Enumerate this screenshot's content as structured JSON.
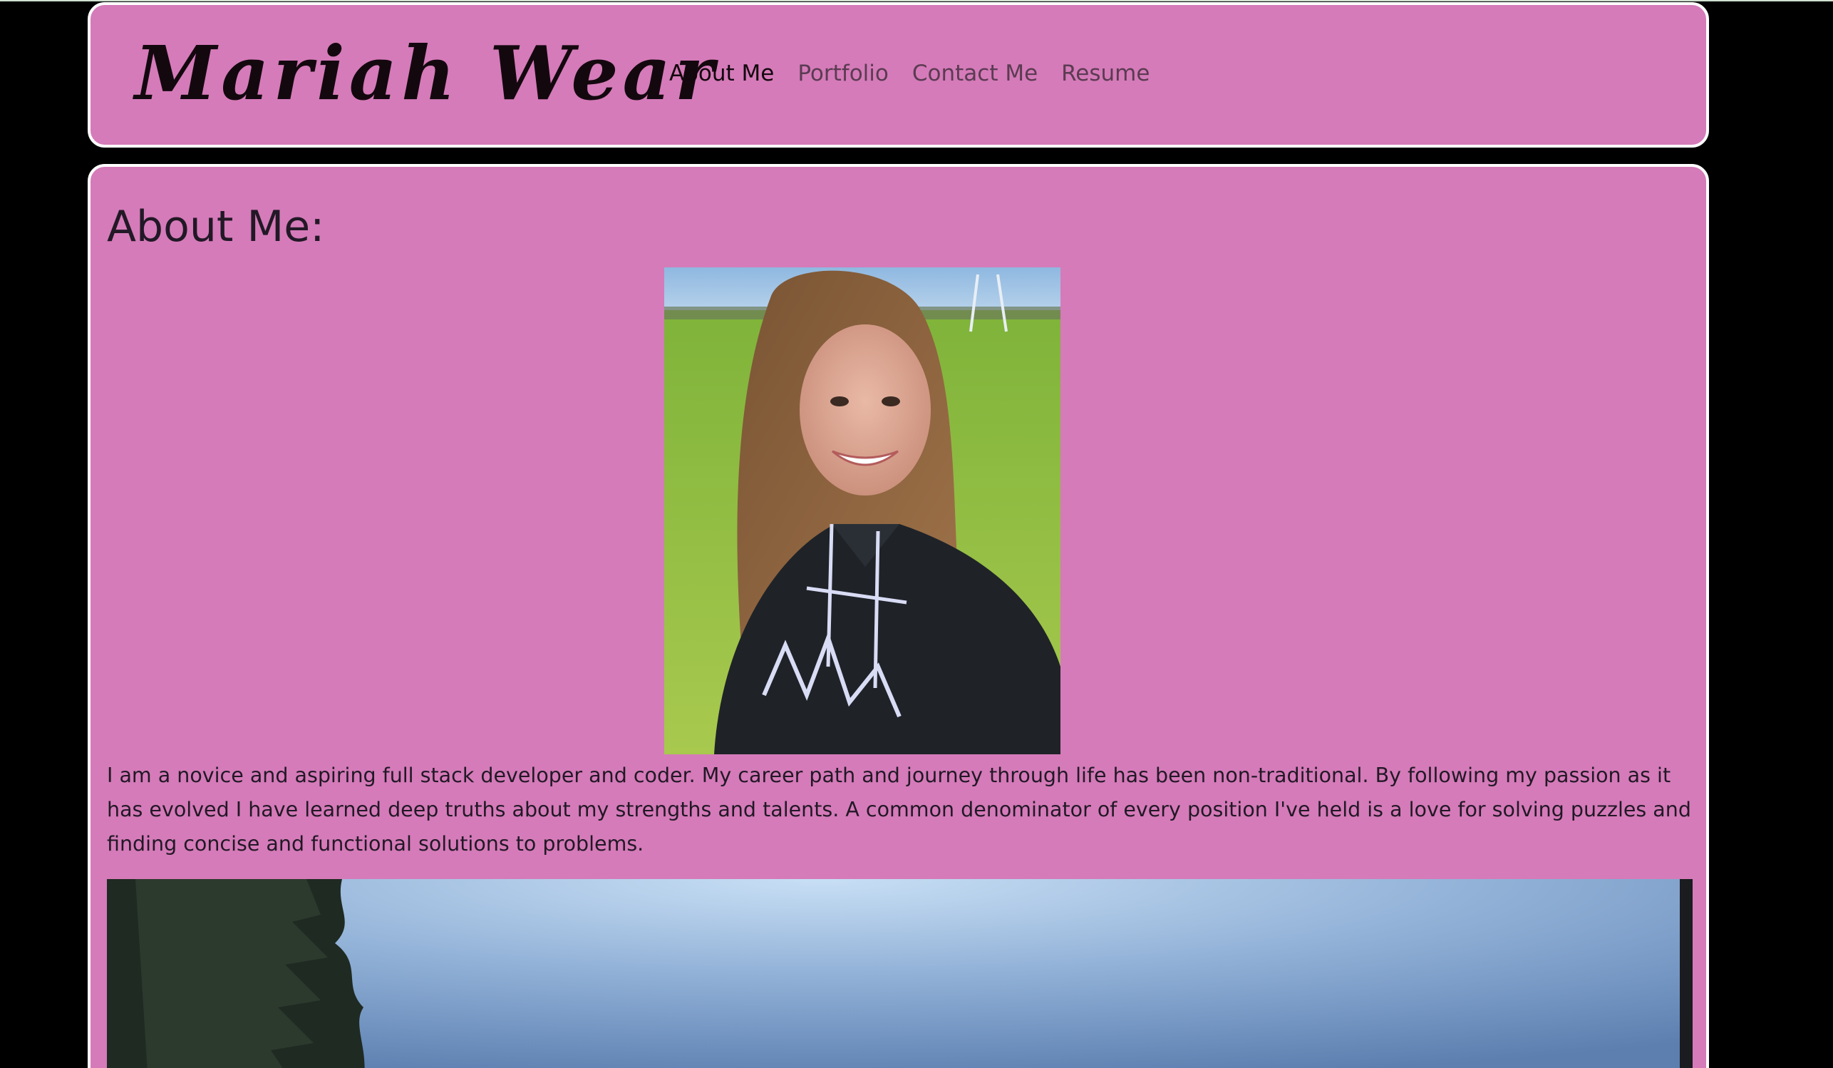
{
  "site": {
    "brand": "Mariah Wear"
  },
  "nav": {
    "items": [
      {
        "label": "About Me",
        "active": true
      },
      {
        "label": "Portfolio",
        "active": false
      },
      {
        "label": "Contact Me",
        "active": false
      },
      {
        "label": "Resume",
        "active": false
      }
    ]
  },
  "about": {
    "heading": "About Me:",
    "intro": "I am a novice and aspiring full stack developer and coder. My career path and journey through life has been non-traditional. By following my passion as it has evolved I have learned deep truths about my strengths and talents. A common denominator of every position I've held is a love for solving puzzles and finding concise and functional solutions to problems."
  },
  "colors": {
    "page_background": "#000000",
    "card_background": "#d57bb9",
    "card_border": "#ffffff",
    "active_link": "#12070d",
    "inactive_link": "#5b3b52",
    "text": "#221826"
  }
}
